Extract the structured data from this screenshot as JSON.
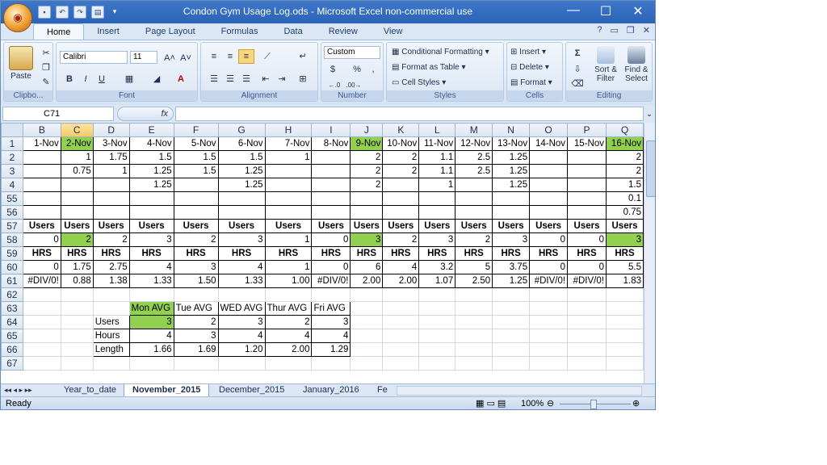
{
  "window": {
    "title": "Condon Gym Usage Log.ods - Microsoft Excel non-commercial use",
    "office_button_glyph": "◉"
  },
  "window_controls": {
    "minimize": "—",
    "maximize": "☐",
    "close": "✕"
  },
  "ribbon_tabs": [
    "Home",
    "Insert",
    "Page Layout",
    "Formulas",
    "Data",
    "Review",
    "View"
  ],
  "ribbon_help": {
    "help": "?",
    "min": "▭",
    "restore": "❐",
    "close": "✕"
  },
  "ribbon": {
    "clipboard": {
      "label": "Clipbo...",
      "paste": "Paste"
    },
    "font": {
      "label": "Font",
      "name": "Calibri",
      "size": "11",
      "bold": "B",
      "italic": "I",
      "underline": "U",
      "grow": "A˄",
      "shrink": "A˅",
      "color_letter": "A"
    },
    "alignment": {
      "label": "Alignment"
    },
    "number": {
      "label": "Number",
      "format": "Custom",
      "currency": "$",
      "percent": "%",
      "comma": ",",
      "inc_dec": "←.0",
      "dec_dec": ".00→"
    },
    "styles": {
      "label": "Styles",
      "conditional": "Conditional Formatting",
      "table": "Format as Table",
      "cell": "Cell Styles"
    },
    "cells": {
      "label": "Cells",
      "insert": "Insert",
      "delete": "Delete",
      "format": "Format"
    },
    "editing": {
      "label": "Editing",
      "sigma": "Σ",
      "sort": "Sort &",
      "filter": "Filter",
      "find": "Find &",
      "select": "Select"
    }
  },
  "formula_bar": {
    "name_box": "C71",
    "fx": "fx",
    "content": ""
  },
  "columns": [
    "B",
    "C",
    "D",
    "E",
    "F",
    "G",
    "H",
    "I",
    "J",
    "K",
    "L",
    "M",
    "N",
    "O",
    "P",
    "Q"
  ],
  "rows": [
    {
      "num": "1",
      "cells": [
        "1-Nov",
        "2-Nov",
        "3-Nov",
        "4-Nov",
        "5-Nov",
        "6-Nov",
        "7-Nov",
        "8-Nov",
        "9-Nov",
        "10-Nov",
        "11-Nov",
        "12-Nov",
        "13-Nov",
        "14-Nov",
        "15-Nov",
        "16-Nov"
      ]
    },
    {
      "num": "2",
      "cells": [
        "",
        "1",
        "1.75",
        "1.5",
        "1.5",
        "1.5",
        "1",
        "",
        "2",
        "2",
        "1.1",
        "2.5",
        "1.25",
        "",
        "",
        "2"
      ]
    },
    {
      "num": "3",
      "cells": [
        "",
        "0.75",
        "1",
        "1.25",
        "1.5",
        "1.25",
        "",
        "",
        "2",
        "2",
        "1.1",
        "2.5",
        "1.25",
        "",
        "",
        "2"
      ]
    },
    {
      "num": "4",
      "cells": [
        "",
        "",
        "",
        "1.25",
        "",
        "1.25",
        "",
        "",
        "2",
        "",
        "1",
        "",
        "1.25",
        "",
        "",
        "1.5"
      ]
    },
    {
      "num": "55",
      "cells": [
        "",
        "",
        "",
        "",
        "",
        "",
        "",
        "",
        "",
        "",
        "",
        "",
        "",
        "",
        "",
        "0.1"
      ]
    },
    {
      "num": "56",
      "cells": [
        "",
        "",
        "",
        "",
        "",
        "",
        "",
        "",
        "",
        "",
        "",
        "",
        "",
        "",
        "",
        "0.75"
      ]
    },
    {
      "num": "57",
      "cells": [
        "Users",
        "Users",
        "Users",
        "Users",
        "Users",
        "Users",
        "Users",
        "Users",
        "Users",
        "Users",
        "Users",
        "Users",
        "Users",
        "Users",
        "Users",
        "Users"
      ]
    },
    {
      "num": "58",
      "cells": [
        "0",
        "2",
        "2",
        "3",
        "2",
        "3",
        "1",
        "0",
        "3",
        "2",
        "3",
        "2",
        "3",
        "0",
        "0",
        "3"
      ]
    },
    {
      "num": "59",
      "cells": [
        "HRS",
        "HRS",
        "HRS",
        "HRS",
        "HRS",
        "HRS",
        "HRS",
        "HRS",
        "HRS",
        "HRS",
        "HRS",
        "HRS",
        "HRS",
        "HRS",
        "HRS",
        "HRS"
      ]
    },
    {
      "num": "60",
      "cells": [
        "0",
        "1.75",
        "2.75",
        "4",
        "3",
        "4",
        "1",
        "0",
        "6",
        "4",
        "3.2",
        "5",
        "3.75",
        "0",
        "0",
        "5.5"
      ]
    },
    {
      "num": "61",
      "cells": [
        "#DIV/0!",
        "0.88",
        "1.38",
        "1.33",
        "1.50",
        "1.33",
        "1.00",
        "#DIV/0!",
        "2.00",
        "2.00",
        "1.07",
        "2.50",
        "1.25",
        "#DIV/0!",
        "#DIV/0!",
        "1.83"
      ]
    },
    {
      "num": "62",
      "cells": [
        "",
        "",
        "",
        "",
        "",
        "",
        "",
        "",
        "",
        "",
        "",
        "",
        "",
        "",
        "",
        ""
      ]
    },
    {
      "num": "63",
      "cells": [
        "",
        "",
        "",
        "Mon AVG",
        "Tue AVG",
        "WED AVG",
        "Thur AVG",
        "Fri AVG",
        "",
        "",
        "",
        "",
        "",
        "",
        "",
        ""
      ]
    },
    {
      "num": "64",
      "cells": [
        "",
        "",
        "Users",
        "3",
        "2",
        "3",
        "2",
        "3",
        "",
        "",
        "",
        "",
        "",
        "",
        "",
        ""
      ]
    },
    {
      "num": "65",
      "cells": [
        "",
        "",
        "Hours",
        "4",
        "3",
        "4",
        "4",
        "4",
        "",
        "",
        "",
        "",
        "",
        "",
        "",
        ""
      ]
    },
    {
      "num": "66",
      "cells": [
        "",
        "",
        "Length",
        "1.66",
        "1.69",
        "1.20",
        "2.00",
        "1.29",
        "",
        "",
        "",
        "",
        "",
        "",
        "",
        ""
      ]
    },
    {
      "num": "67",
      "cells": [
        "",
        "",
        "",
        "",
        "",
        "",
        "",
        "",
        "",
        "",
        "",
        "",
        "",
        "",
        "",
        ""
      ]
    }
  ],
  "sheet_tabs": [
    "Year_to_date",
    "November_2015",
    "December_2015",
    "January_2016",
    "Fe"
  ],
  "active_sheet": "November_2015",
  "status": {
    "ready": "Ready",
    "zoom": "100%"
  },
  "colors": {
    "highlight_green": "#92d050",
    "header_highlight": "#f7c95c",
    "title_bar": "#2a63b8"
  }
}
